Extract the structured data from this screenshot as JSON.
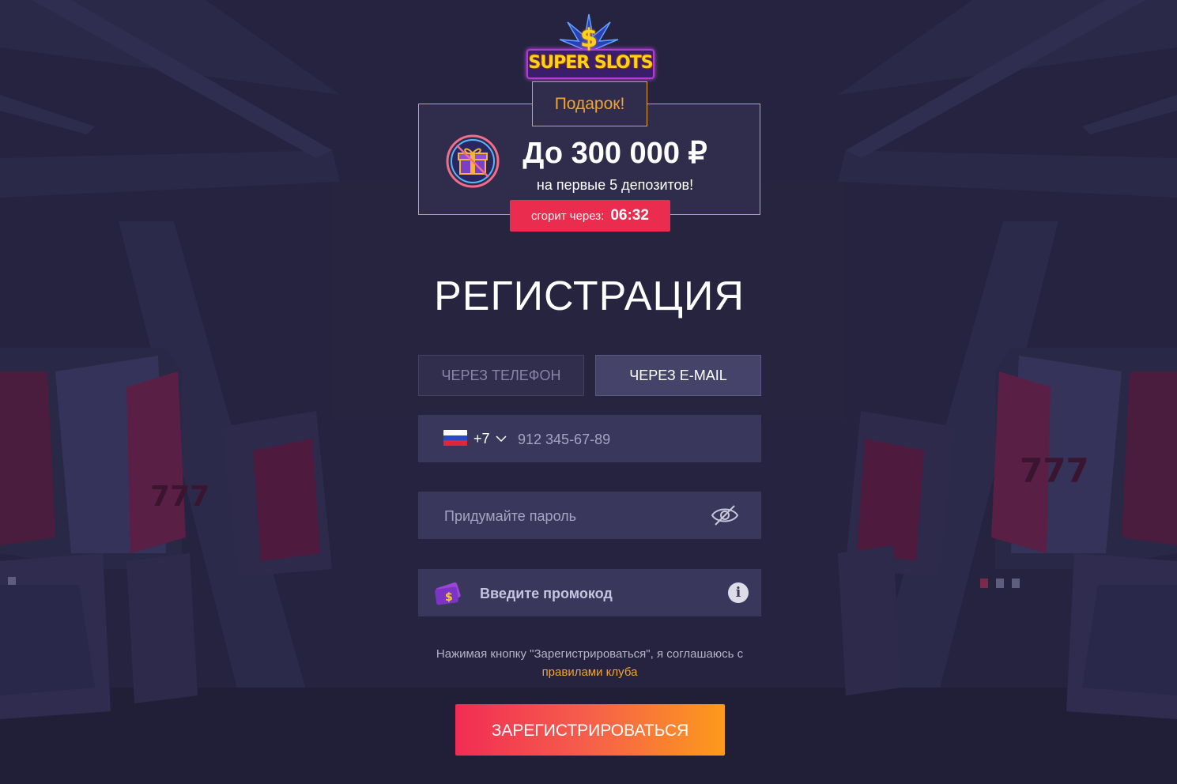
{
  "logo": {
    "text_left": "SUPER",
    "text_right": "SLOTS",
    "symbol": "$"
  },
  "gift": {
    "tab_label": "Подарок!",
    "amount": "До 300 000 ₽",
    "subtitle": "на первые 5 депозитов!",
    "icon": "gift-icon",
    "timer_label": "сгорит через:",
    "timer_value": "06:32"
  },
  "registration": {
    "title": "РЕГИСТРАЦИЯ",
    "tabs": [
      {
        "label": "ЧЕРЕЗ ТЕЛЕФОН",
        "active": false
      },
      {
        "label": "ЧЕРЕЗ E-MAIL",
        "active": true
      }
    ],
    "phone": {
      "country_icon": "russia-flag-icon",
      "code": "+7",
      "placeholder": "912 345-67-89"
    },
    "password": {
      "placeholder": "Придумайте пароль",
      "toggle_icon": "eye-slash-icon"
    },
    "promo": {
      "icon": "ticket-icon",
      "placeholder": "Введите промокод",
      "info_icon": "info-icon",
      "info_symbol": "i"
    },
    "terms_text": "Нажимая кнопку \"Зарегистрироваться\", я соглашаюсь с",
    "terms_link": "правилами клуба",
    "submit_label": "ЗАРЕГИСТРИРОВАТЬСЯ"
  },
  "colors": {
    "background": "#25233f",
    "accent_orange": "#f2a42c",
    "timer_red": "#ea2d4e",
    "field_bg": "#3a375c"
  }
}
